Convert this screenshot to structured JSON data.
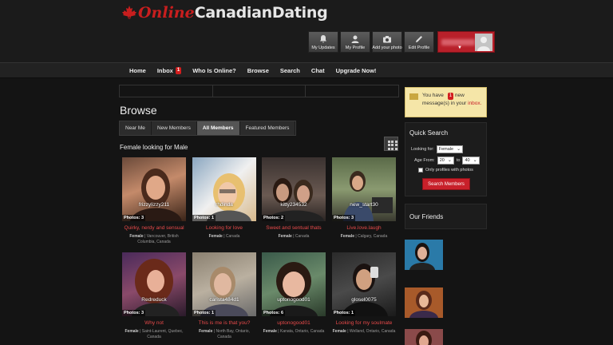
{
  "brand": {
    "logo_online": "Online",
    "logo_rest": "CanadianDating",
    "colors": {
      "accent": "#c8202a",
      "background": "#141414",
      "notice": "#f5e6a8"
    }
  },
  "toolbar": [
    {
      "label": "My Updates",
      "icon": "updates-icon"
    },
    {
      "label": "My Profile",
      "icon": "profile-icon"
    },
    {
      "label": "Add your photo",
      "icon": "camera-icon"
    },
    {
      "label": "Edit Profile",
      "icon": "pencil-icon"
    }
  ],
  "nav": {
    "home": "Home",
    "inbox": "Inbox",
    "inbox_count": "1",
    "who": "Who Is Online?",
    "browse": "Browse",
    "search": "Search",
    "chat": "Chat",
    "upgrade": "Upgrade Now!"
  },
  "main": {
    "title": "Browse",
    "tabs": [
      "Near Me",
      "New Members",
      "All Members",
      "Featured Members"
    ],
    "active_tab": "All Members",
    "section_title": "Female looking for Male"
  },
  "members": [
    {
      "name": "frizzylizzy211",
      "photos": "Photos: 3",
      "tagline": "Quirky, nerdy and sensual",
      "gender": "Female",
      "location": "Vancouver, British Columbia, Canada"
    },
    {
      "name": "rhdinda",
      "photos": "Photos: 1",
      "tagline": "Looking for love",
      "gender": "Female",
      "location": "Canada"
    },
    {
      "name": "kitty234532",
      "photos": "Photos: 2",
      "tagline": "Sweet and sentual thats",
      "gender": "Female",
      "location": "Canada"
    },
    {
      "name": "new_start30",
      "photos": "Photos: 3",
      "tagline": "Live.love.laugh",
      "gender": "Female",
      "location": "Calgary, Canada"
    },
    {
      "name": "Redreduck",
      "photos": "Photos: 3",
      "tagline": "Why not",
      "gender": "Female",
      "location": "Saint-Laurent, Quebec, Canada"
    },
    {
      "name": "carista484d1",
      "photos": "Photos: 1",
      "tagline": "This is me is that you?",
      "gender": "Female",
      "location": "North Bay, Ontario, Canada"
    },
    {
      "name": "uptonogood01",
      "photos": "Photos: 6",
      "tagline": "uptonogood01",
      "gender": "Female",
      "location": "Kanata, Ontario, Canada"
    },
    {
      "name": "glosel0075",
      "photos": "Photos: 1",
      "tagline": "Looking for my soulmate",
      "gender": "Female",
      "location": "Welland, Ontario, Canada"
    }
  ],
  "sidebar": {
    "message": {
      "pre": "You have",
      "count": "1",
      "post": "new message(s) in your",
      "link": "inbox."
    },
    "quick_search": {
      "title": "Quick Search",
      "looking_for_label": "Looking for:",
      "looking_for_value": "Female",
      "age_from_label": "Age From:",
      "age_from": "20",
      "age_to_label": "to",
      "age_to": "40",
      "photos_only_label": "Only profiles with photos",
      "button": "Search Members"
    },
    "friends_title": "Our Friends"
  }
}
